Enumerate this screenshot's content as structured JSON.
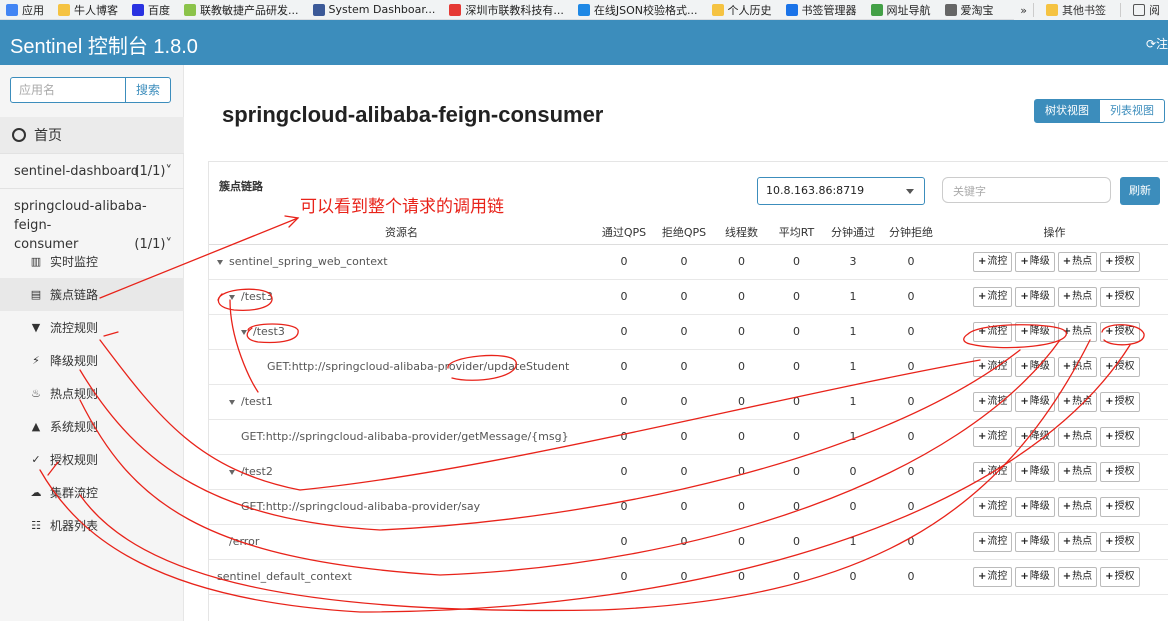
{
  "bookmarks": [
    {
      "label": "应用",
      "color": "#4285f4"
    },
    {
      "label": "牛人博客",
      "color": "#f5c342"
    },
    {
      "label": "百度",
      "color": "#2932e1"
    },
    {
      "label": "联教敏捷产品研发...",
      "color": "#8bc34a"
    },
    {
      "label": "System Dashboar...",
      "color": "#3b5998"
    },
    {
      "label": "深圳市联教科技有...",
      "color": "#e53935"
    },
    {
      "label": "在线JSON校验格式...",
      "color": "#1e88e5"
    },
    {
      "label": "个人历史",
      "color": "#f5c342"
    },
    {
      "label": "书签管理器",
      "color": "#1a73e8"
    },
    {
      "label": "网址导航",
      "color": "#43a047"
    },
    {
      "label": "爱淘宝",
      "color": "#666666"
    }
  ],
  "bookmarks_right": {
    "more": "»",
    "other": "其他书签",
    "reading": "阅"
  },
  "header": {
    "brand": "Sentinel 控制台 1.8.0",
    "logout": "⟳注"
  },
  "sidebar": {
    "search_placeholder": "应用名",
    "search_button": "搜索",
    "home": "首页",
    "apps": [
      {
        "name": "sentinel-dashboard",
        "count": "(1/1)"
      },
      {
        "name_line1": "springcloud-alibaba-feign-",
        "name_line2": "consumer",
        "count": "(1/1)"
      }
    ],
    "menu": [
      {
        "label": "实时监控",
        "icon": "▥"
      },
      {
        "label": "簇点链路",
        "icon": "▤"
      },
      {
        "label": "流控规则",
        "icon": "▼"
      },
      {
        "label": "降级规则",
        "icon": "⚡"
      },
      {
        "label": "热点规则",
        "icon": "♨"
      },
      {
        "label": "系统规则",
        "icon": "▲"
      },
      {
        "label": "授权规则",
        "icon": "✓"
      },
      {
        "label": "集群流控",
        "icon": "☁"
      },
      {
        "label": "机器列表",
        "icon": "☷"
      }
    ]
  },
  "main": {
    "title": "springcloud-alibaba-feign-consumer",
    "view_tree": "树状视图",
    "view_list": "列表视图",
    "panel_title": "簇点链路",
    "machine": "10.8.163.86:8719",
    "keyword_placeholder": "关键字",
    "refresh": "刷新",
    "annotation": "可以看到整个请求的调用链"
  },
  "table": {
    "headers": [
      "资源名",
      "通过QPS",
      "拒绝QPS",
      "线程数",
      "平均RT",
      "分钟通过",
      "分钟拒绝",
      "操作"
    ],
    "op_labels": [
      "流控",
      "降级",
      "热点",
      "授权"
    ],
    "rows": [
      {
        "name": "sentinel_spring_web_context",
        "indent": 0,
        "toggle": true,
        "values": [
          "0",
          "0",
          "0",
          "0",
          "3",
          "0"
        ]
      },
      {
        "name": "/test3",
        "indent": 1,
        "toggle": true,
        "values": [
          "0",
          "0",
          "0",
          "0",
          "1",
          "0"
        ]
      },
      {
        "name": "/test3",
        "indent": 2,
        "toggle": true,
        "values": [
          "0",
          "0",
          "0",
          "0",
          "1",
          "0"
        ]
      },
      {
        "name": "GET:http://springcloud-alibaba-provider/updateStudent",
        "indent": 3,
        "toggle": false,
        "values": [
          "0",
          "0",
          "0",
          "0",
          "1",
          "0"
        ]
      },
      {
        "name": "/test1",
        "indent": 1,
        "toggle": true,
        "values": [
          "0",
          "0",
          "0",
          "0",
          "1",
          "0"
        ]
      },
      {
        "name": "GET:http://springcloud-alibaba-provider/getMessage/{msg}",
        "indent": 2,
        "toggle": false,
        "values": [
          "0",
          "0",
          "0",
          "0",
          "1",
          "0"
        ]
      },
      {
        "name": "/test2",
        "indent": 1,
        "toggle": true,
        "values": [
          "0",
          "0",
          "0",
          "0",
          "0",
          "0"
        ]
      },
      {
        "name": "GET:http://springcloud-alibaba-provider/say",
        "indent": 2,
        "toggle": false,
        "values": [
          "0",
          "0",
          "0",
          "0",
          "0",
          "0"
        ]
      },
      {
        "name": "/error",
        "indent": 1,
        "toggle": false,
        "values": [
          "0",
          "0",
          "0",
          "0",
          "1",
          "0"
        ]
      },
      {
        "name": "sentinel_default_context",
        "indent": 0,
        "toggle": false,
        "values": [
          "0",
          "0",
          "0",
          "0",
          "0",
          "0"
        ]
      }
    ]
  },
  "colors": {
    "primary": "#3c8dbc",
    "annotation": "#e8231a"
  }
}
